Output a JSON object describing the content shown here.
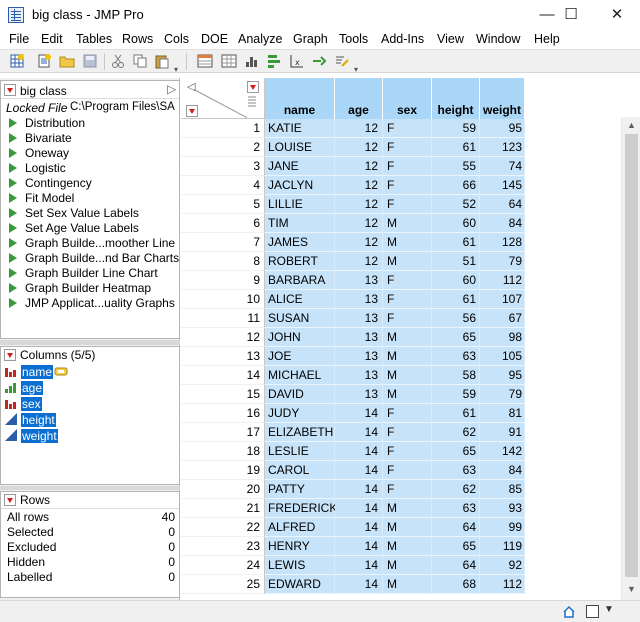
{
  "window": {
    "title": "big class - JMP Pro",
    "minimize": "—",
    "maximize": "☐",
    "close": "✕"
  },
  "menu": [
    "File",
    "Edit",
    "Tables",
    "Rows",
    "Cols",
    "DOE",
    "Analyze",
    "Graph",
    "Tools",
    "Add-Ins",
    "View",
    "Window",
    "Help"
  ],
  "table_panel": {
    "name": "big class",
    "locked_label": "Locked File",
    "locked_path": "C:\\Program Files\\SA",
    "scripts": [
      "Distribution",
      "Bivariate",
      "Oneway",
      "Logistic",
      "Contingency",
      "Fit Model",
      "Set Sex Value Labels",
      "Set Age Value Labels",
      "Graph Builde...moother Line",
      "Graph Builde...nd Bar Charts",
      "Graph Builder Line Chart",
      "Graph Builder Heatmap",
      "JMP Applicat...uality Graphs"
    ]
  },
  "columns_panel": {
    "title": "Columns (5/5)",
    "columns": [
      {
        "name": "name",
        "icon": "nominal-bar-icon",
        "key": true
      },
      {
        "name": "age",
        "icon": "ordinal-bar-icon",
        "key": false
      },
      {
        "name": "sex",
        "icon": "nominal-bar-icon",
        "key": false
      },
      {
        "name": "height",
        "icon": "continuous-triangle-icon",
        "key": false
      },
      {
        "name": "weight",
        "icon": "continuous-triangle-icon",
        "key": false
      }
    ]
  },
  "rows_panel": {
    "title": "Rows",
    "stats": [
      {
        "label": "All rows",
        "value": "40"
      },
      {
        "label": "Selected",
        "value": "0"
      },
      {
        "label": "Excluded",
        "value": "0"
      },
      {
        "label": "Hidden",
        "value": "0"
      },
      {
        "label": "Labelled",
        "value": "0"
      }
    ]
  },
  "grid": {
    "headers": [
      "name",
      "age",
      "sex",
      "height",
      "weight"
    ],
    "rows": [
      [
        "1",
        "KATIE",
        "12",
        "F",
        "59",
        "95"
      ],
      [
        "2",
        "LOUISE",
        "12",
        "F",
        "61",
        "123"
      ],
      [
        "3",
        "JANE",
        "12",
        "F",
        "55",
        "74"
      ],
      [
        "4",
        "JACLYN",
        "12",
        "F",
        "66",
        "145"
      ],
      [
        "5",
        "LILLIE",
        "12",
        "F",
        "52",
        "64"
      ],
      [
        "6",
        "TIM",
        "12",
        "M",
        "60",
        "84"
      ],
      [
        "7",
        "JAMES",
        "12",
        "M",
        "61",
        "128"
      ],
      [
        "8",
        "ROBERT",
        "12",
        "M",
        "51",
        "79"
      ],
      [
        "9",
        "BARBARA",
        "13",
        "F",
        "60",
        "112"
      ],
      [
        "10",
        "ALICE",
        "13",
        "F",
        "61",
        "107"
      ],
      [
        "11",
        "SUSAN",
        "13",
        "F",
        "56",
        "67"
      ],
      [
        "12",
        "JOHN",
        "13",
        "M",
        "65",
        "98"
      ],
      [
        "13",
        "JOE",
        "13",
        "M",
        "63",
        "105"
      ],
      [
        "14",
        "MICHAEL",
        "13",
        "M",
        "58",
        "95"
      ],
      [
        "15",
        "DAVID",
        "13",
        "M",
        "59",
        "79"
      ],
      [
        "16",
        "JUDY",
        "14",
        "F",
        "61",
        "81"
      ],
      [
        "17",
        "ELIZABETH",
        "14",
        "F",
        "62",
        "91"
      ],
      [
        "18",
        "LESLIE",
        "14",
        "F",
        "65",
        "142"
      ],
      [
        "19",
        "CAROL",
        "14",
        "F",
        "63",
        "84"
      ],
      [
        "20",
        "PATTY",
        "14",
        "F",
        "62",
        "85"
      ],
      [
        "21",
        "FREDERICK",
        "14",
        "M",
        "63",
        "93"
      ],
      [
        "22",
        "ALFRED",
        "14",
        "M",
        "64",
        "99"
      ],
      [
        "23",
        "HENRY",
        "14",
        "M",
        "65",
        "119"
      ],
      [
        "24",
        "LEWIS",
        "14",
        "M",
        "64",
        "92"
      ],
      [
        "25",
        "EDWARD",
        "14",
        "M",
        "68",
        "112"
      ]
    ]
  },
  "colors": {
    "header_blue": "#aad6f7",
    "cell_blue": "#c6e3f9",
    "selection_blue": "#0b6fd1",
    "script_green": "#3a9a3a",
    "hotspot_red": "#d41d1d"
  }
}
